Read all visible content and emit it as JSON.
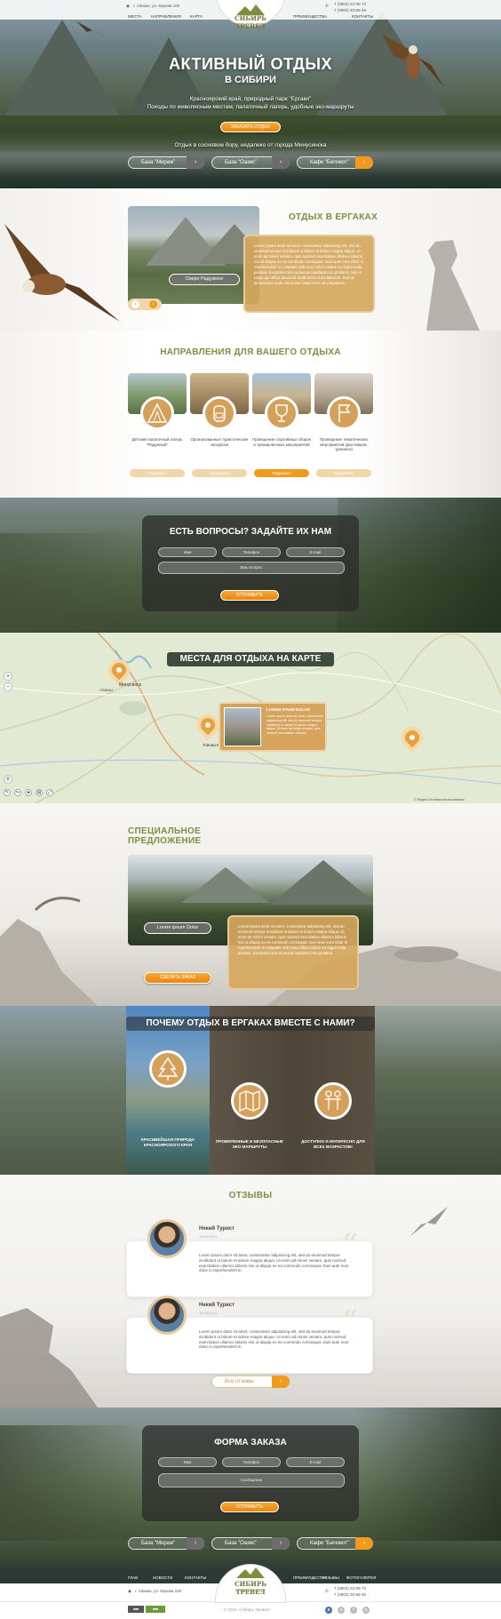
{
  "header": {
    "address": "г. Абакан, ул. Кирова 100",
    "nav_left": [
      "МЕСТА",
      "НАПРАВЛЕНИЯ",
      "КАРТА"
    ],
    "nav_right": [
      "ПРЕИМУЩЕСТВА",
      "КОНТАКТЫ"
    ],
    "logo_title": "СИБИРЬ ТРЕВЕЛ",
    "logo_sub": "Активный отдых",
    "phone1": "7 (3902) 22-05-73",
    "phone2": "7 (3902) 20-65-45"
  },
  "hero": {
    "title": "АКТИВНЫЙ ОТДЫХ",
    "subtitle": "В СИБИРИ",
    "line1": "Красноярский край, природный парк \"Ергаки\"",
    "line2": "Походы по живописным местам, палаточный лагерь, удобные эко-маршруты",
    "button": "ЗАКАЗАТЬ ОТДЫХ",
    "note": "Отдых в сосновом бору, недалеко от города Минусинска",
    "places": [
      "База \"Мираж\"",
      "База \"Оазис\"",
      "Кафе \"Бегемот\""
    ]
  },
  "ergaki": {
    "title": "ОТДЫХ В ЕРГАКАХ",
    "photo_label": "Озеро Радужное",
    "text": "Lorem ipsum dolor sit amet, consectetur adipisicing elit, sed do eiusmod tempor incididunt ut labore et dolore magna aliqua. Ut enim ad minim veniam, quis nostrud exercitation ullamco laboris nisi ut aliquip ex ea commodo consequat. Duis aute irure dolor in reprehenderit in voluptate velit esse cillum dolore eu fugiat nulla pariatur. Excepteur sint occaecat cupidatat non proident, sunt in culpa qui officia deserunt mollit anim id est laborum. Sed ut perspiciatis unde omnis iste natus error sit voluptatem."
  },
  "directions": {
    "title": "НАПРАВЛЕНИЯ ДЛЯ ВАШЕГО ОТДЫХА",
    "items": [
      {
        "text": "Детский палаточный лагерь \"Радужный\"",
        "button": "Подробнее"
      },
      {
        "text": "Организованные туристические экскурсии",
        "button": "Подробнее"
      },
      {
        "text": "Проведение спортивных сборов и тренировочных мероприятий",
        "button": "Подробнее"
      },
      {
        "text": "Проведение тематических мероприятий (фестивали, тренинги)",
        "button": "Подробнее"
      }
    ]
  },
  "questions": {
    "title": "ЕСТЬ ВОПРОСЫ? ЗАДАЙТЕ ИХ НАМ",
    "name": "Имя",
    "phone": "Телефон",
    "email": "E-mail",
    "question": "Ваш вопрос",
    "button": "ОТПРАВИТЬ"
  },
  "map": {
    "title": "МЕСТА ДЛЯ ОТДЫХА НА КАРТЕ",
    "card_title": "LOREM IPSUM DOLOR",
    "card_text": "Lorem ipsum dolor sit amet, consectetur adipisicing elit, sed do eiusmod tempor incididunt ut labore et dolore magna aliqua. Ut enim ad minim veniam, quis nostrud exercitation ullamco.",
    "city1": "Минусинск",
    "city2": "Абакан",
    "city3": "Тойова-Булак",
    "copyright": "© Яндекс  Условия использования"
  },
  "special": {
    "title": "СПЕЦИАЛЬНОЕ ПРЕДЛОЖЕНИЕ",
    "photo_label": "Lorem ipsum Dolor",
    "text": "Lorem ipsum dolor sit amet, consectetur adipisicing elit, sed do eiusmod tempor incididunt ut labore et dolore magna aliqua. Ut enim ad minim veniam, quis nostrud exercitation ullamco laboris nisi ut aliquip ex ea commodo consequat. Duis aute irure dolor in reprehenderit in voluptate velit esse cillum dolore eu fugiat nulla pariatur. Excepteur sint occaecat cupidatat non proident.",
    "button": "СДЕЛАТЬ ЗАКАЗ"
  },
  "why": {
    "title": "ПОЧЕМУ ОТДЫХ В ЕРГАКАХ ВМЕСТЕ С НАМИ?",
    "items": [
      "КРАСИВЕЙШАЯ ПРИРОДА КРАСНОЯРСКОГО КРАЯ",
      "ПРОВЕРЕННЫЕ И БЕЗОПАСНЫЕ ЭКО МАРШРУТЫ",
      "ДОСТУПНО И ИНТЕРЕСНО ДЛЯ ВСЕХ ВОЗРАСТОВ!"
    ]
  },
  "reviews": {
    "title": "ОТЗЫВЫ",
    "items": [
      {
        "name": "Некий Турист",
        "date": "12.05.2014",
        "text": "Lorem ipsum dolor sit amet, consectetur adipisicing elit, sed do eiusmod tempor incididunt ut labore et dolore magna aliqua. Ut enim ad minim veniam, quis nostrud exercitation ullamco laboris nisi ut aliquip ex ea commodo consequat. Duis aute irure dolor in reprehenderit in."
      },
      {
        "name": "Некий Турист",
        "date": "12.05.2014",
        "text": "Lorem ipsum dolor sit amet, consectetur adipisicing elit, sed do eiusmod tempor incididunt ut labore et dolore magna aliqua. Ut enim ad minim veniam, quis nostrud exercitation ullamco laboris nisi ut aliquip ex ea commodo consequat. Duis aute irure dolor in reprehenderit in."
      }
    ],
    "all": "Все отзывы"
  },
  "order": {
    "title": "ФОРМА ЗАКАЗА",
    "name": "Имя",
    "phone": "Телефон",
    "email": "E-mail",
    "message": "Сообщение",
    "button": "ОТПРАВИТЬ"
  },
  "footer": {
    "places": [
      "База \"Мираж\"",
      "База \"Оазис\"",
      "Кафе \"Бегемот\""
    ],
    "nav_left": [
      "ГЛАВ",
      "НОВОСТИ",
      "КОНТАКТЫ"
    ],
    "nav_right": [
      "ПРЕИМУЩЕСТВА",
      "ОТЗЫВЫ",
      "ФОТОГАЛЕРЕЯ"
    ],
    "address": "г. Абакан, ул. Кирова 100",
    "phone1": "7 (3902) 22-05-73",
    "phone2": "7 (3902) 20-65-45",
    "copyright": "© 2015 «Сибирь Тревел»",
    "accent": "#f19a1d",
    "olive": "#7d8f3e"
  }
}
